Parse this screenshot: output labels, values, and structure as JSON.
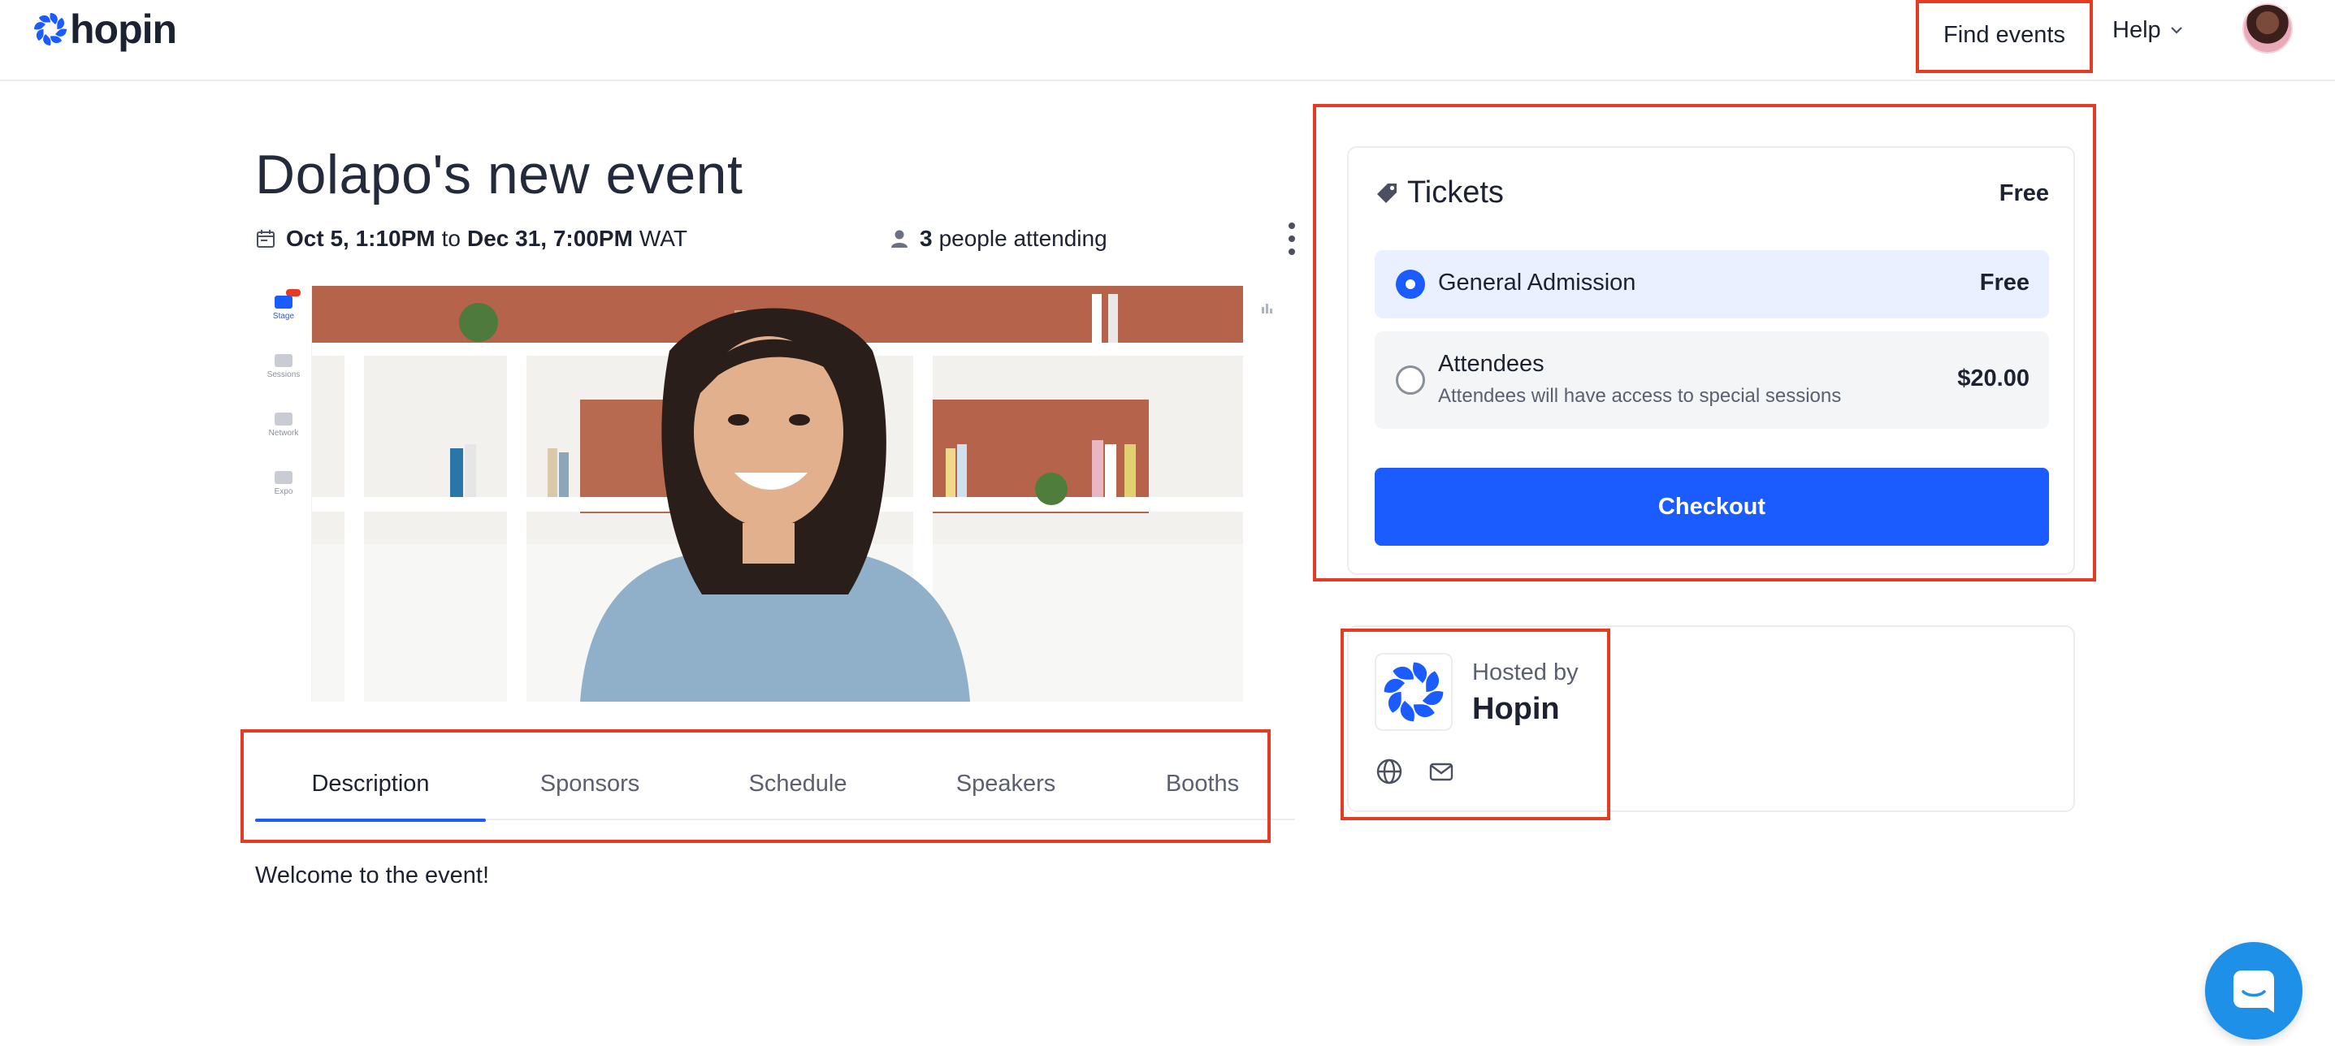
{
  "header": {
    "logo_text": "hopin",
    "find_events_label": "Find events",
    "help_label": "Help"
  },
  "event": {
    "title": "Dolapo's new event",
    "start": "Oct 5, 1:10PM",
    "to_word": "to",
    "end": "Dec 31, 7:00PM",
    "timezone": "WAT",
    "attending_count": "3",
    "attending_label": "people attending"
  },
  "preview_sidebar": {
    "items": [
      {
        "label": "Stage"
      },
      {
        "label": "Sessions"
      },
      {
        "label": "Network"
      },
      {
        "label": "Expo"
      }
    ]
  },
  "tabs": [
    {
      "label": "Description",
      "active": true
    },
    {
      "label": "Sponsors"
    },
    {
      "label": "Schedule"
    },
    {
      "label": "Speakers"
    },
    {
      "label": "Booths"
    }
  ],
  "description_text": "Welcome to the event!",
  "tickets": {
    "heading": "Tickets",
    "price_summary": "Free",
    "options": [
      {
        "name": "General Admission",
        "price": "Free",
        "selected": true
      },
      {
        "name": "Attendees",
        "subtitle": "Attendees will have access to special sessions",
        "price": "$20.00",
        "selected": false
      }
    ],
    "checkout_label": "Checkout"
  },
  "host": {
    "hosted_by_label": "Hosted by",
    "name": "Hopin"
  },
  "colors": {
    "accent": "#1a5cff",
    "annotation": "#e53a24",
    "chat": "#1e90e8"
  }
}
